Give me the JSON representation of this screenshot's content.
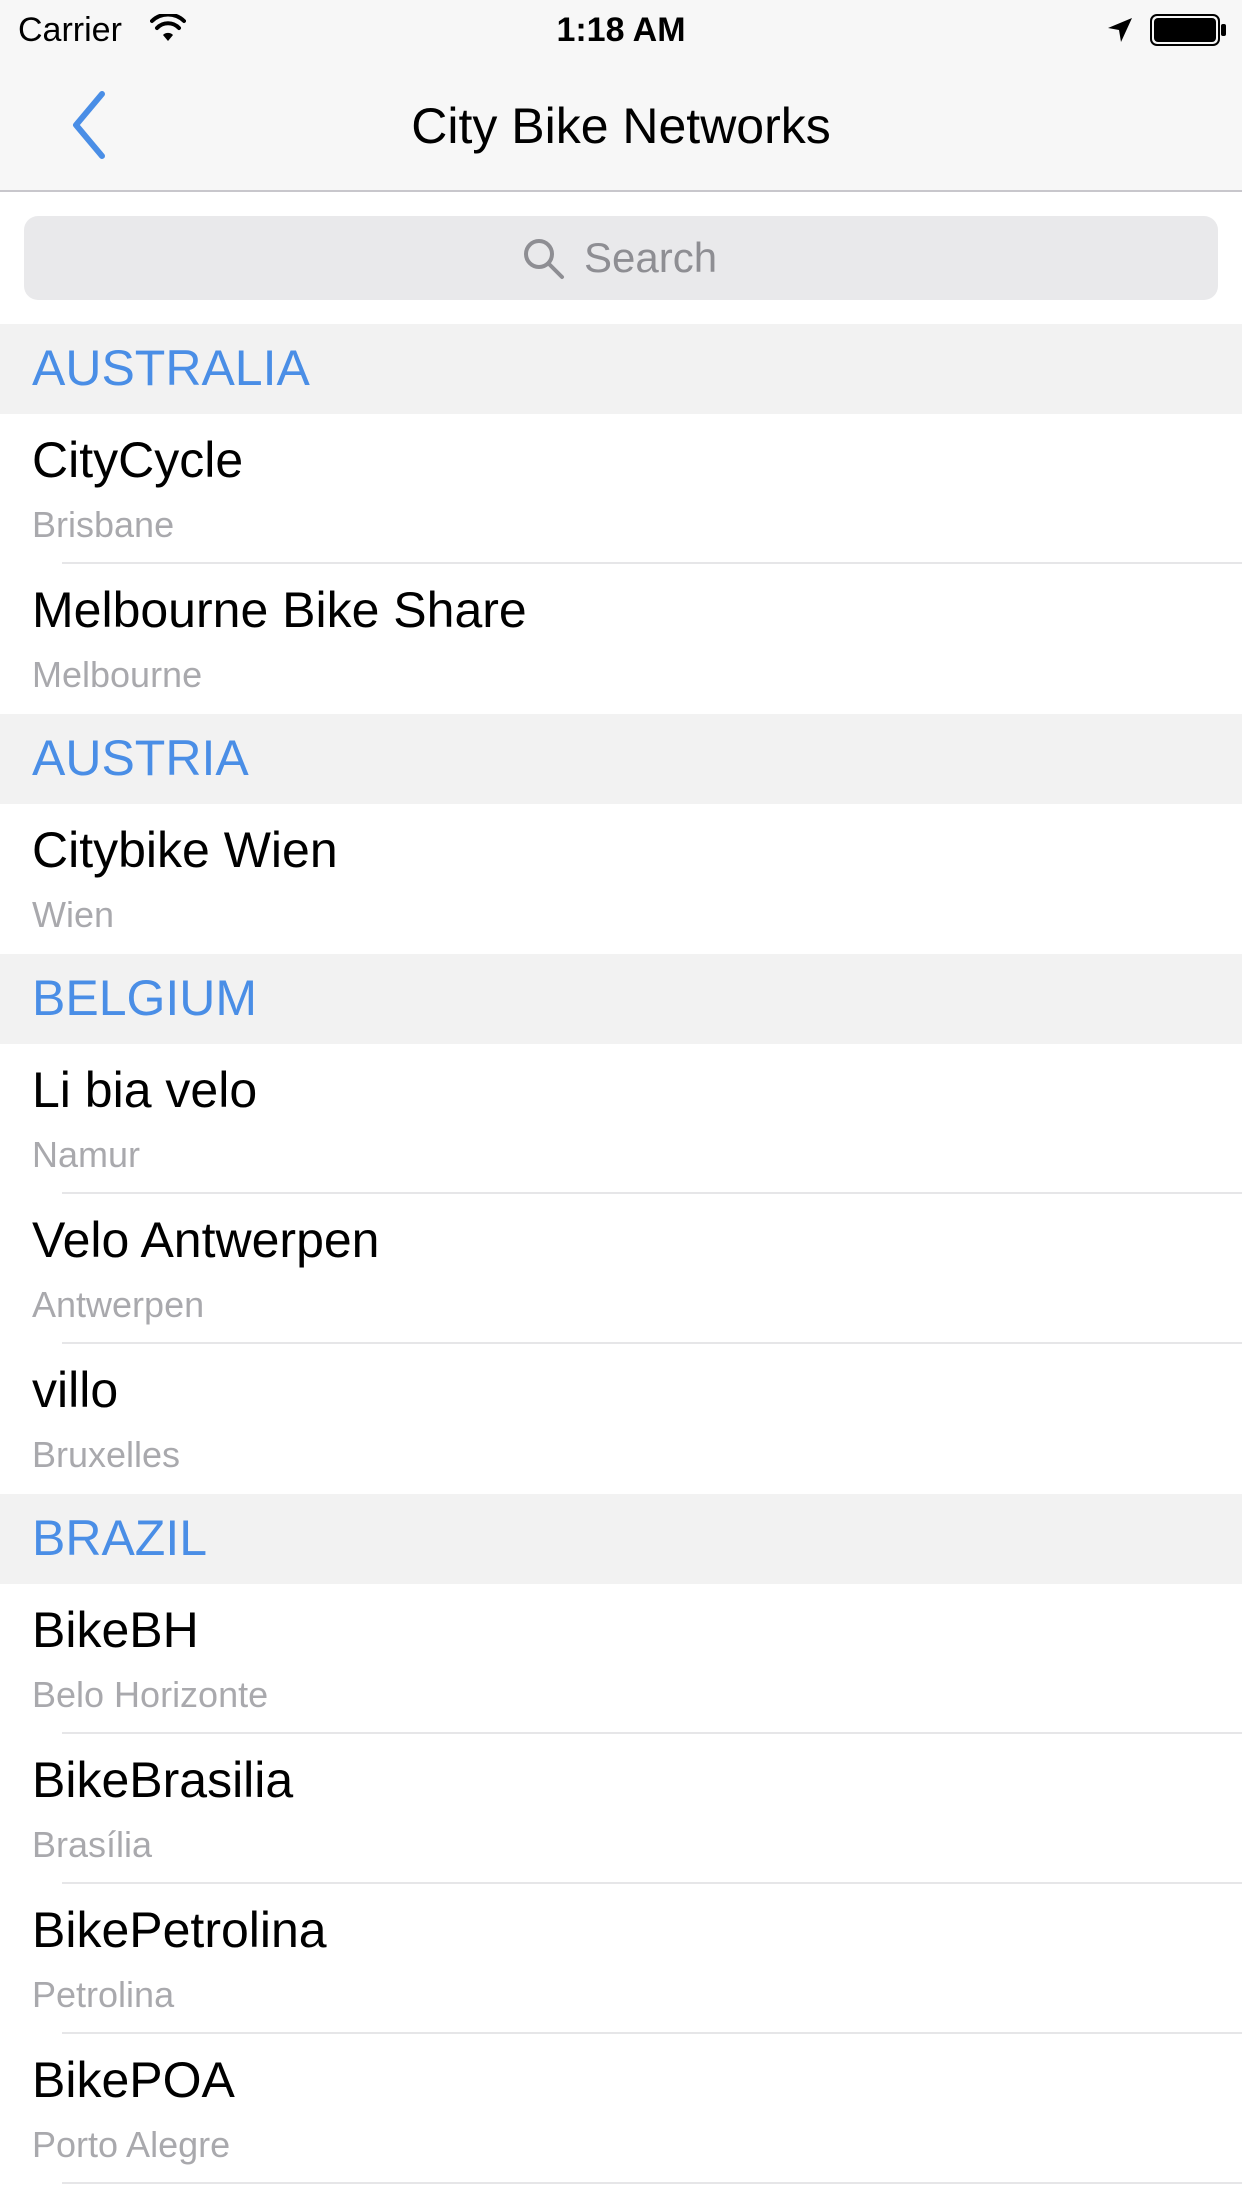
{
  "status_bar": {
    "carrier": "Carrier",
    "time": "1:18 AM",
    "icons": [
      "wifi-icon",
      "location-arrow-icon",
      "battery-icon"
    ]
  },
  "nav": {
    "title": "City Bike Networks",
    "back_icon": "chevron-left-icon",
    "accent_color": "#4a8ee6"
  },
  "search": {
    "placeholder": "Search",
    "value": "",
    "icon": "search-icon"
  },
  "sections": [
    {
      "title": "AUSTRALIA",
      "rows": [
        {
          "name": "CityCycle",
          "city": "Brisbane"
        },
        {
          "name": "Melbourne Bike Share",
          "city": "Melbourne"
        }
      ]
    },
    {
      "title": "AUSTRIA",
      "rows": [
        {
          "name": "Citybike Wien",
          "city": "Wien"
        }
      ]
    },
    {
      "title": "BELGIUM",
      "rows": [
        {
          "name": "Li bia velo",
          "city": "Namur"
        },
        {
          "name": "Velo Antwerpen",
          "city": "Antwerpen"
        },
        {
          "name": "villo",
          "city": "Bruxelles"
        }
      ]
    },
    {
      "title": "BRAZIL",
      "rows": [
        {
          "name": "BikeBH",
          "city": "Belo Horizonte"
        },
        {
          "name": "BikeBrasilia",
          "city": "Brasília"
        },
        {
          "name": "BikePetrolina",
          "city": "Petrolina"
        },
        {
          "name": "BikePOA",
          "city": "Porto Alegre"
        }
      ]
    }
  ]
}
